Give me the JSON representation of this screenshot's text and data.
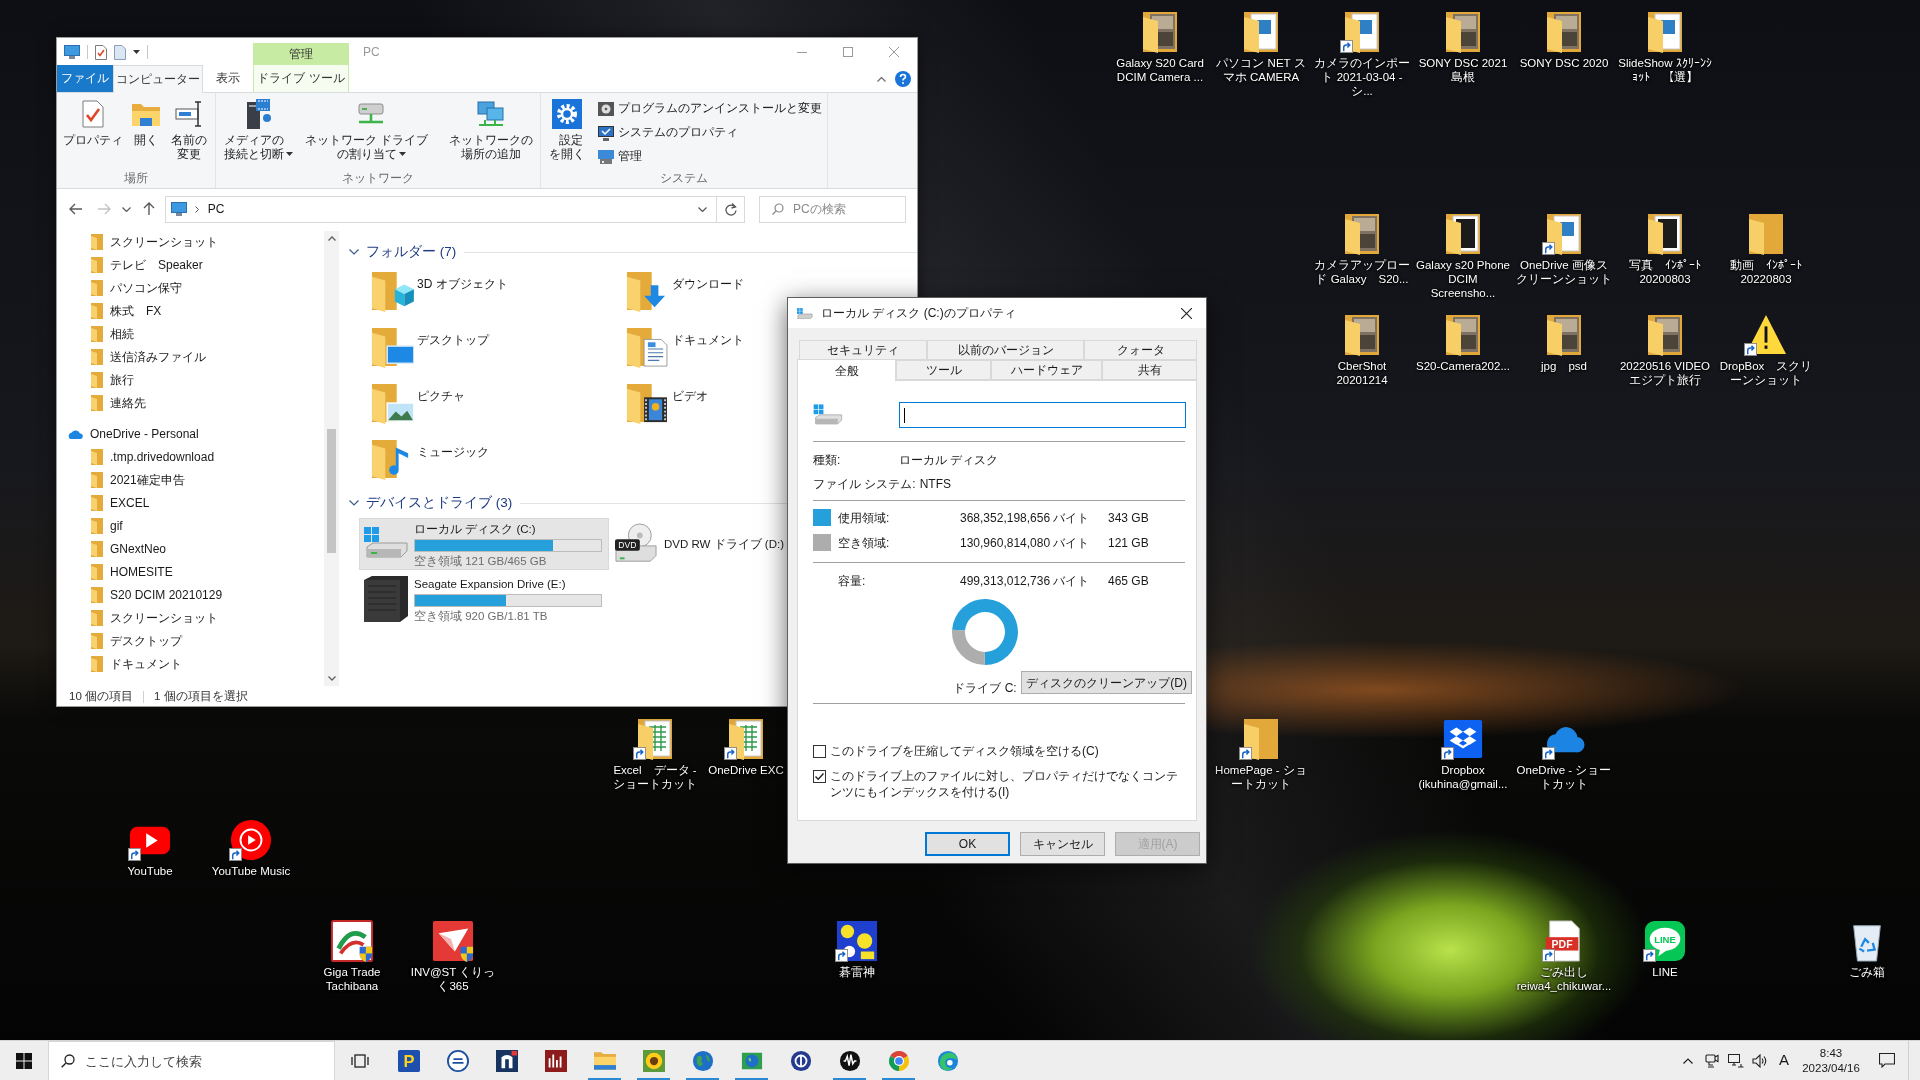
{
  "desktop_icons": [
    {
      "label": "Galaxy S20 Card DCIM Camera ...",
      "kind": "folder-photo",
      "shortcut": false
    },
    {
      "label": "パソコン NET スマホ CAMERA",
      "kind": "folder-doc",
      "shortcut": false
    },
    {
      "label": "カメラのインポート 2021-03-04 - シ...",
      "kind": "folder-doc",
      "shortcut": true
    },
    {
      "label": "SONY DSC 2021 島根",
      "kind": "folder-photo",
      "shortcut": false
    },
    {
      "label": "SONY DSC 2020",
      "kind": "folder-photo",
      "shortcut": false
    },
    {
      "label": "SlideShow ｽｸﾘｰﾝｼｮｯﾄ　【選】",
      "kind": "folder-doc",
      "shortcut": false
    },
    {
      "label": "カメラアップロード Galaxy　S20...",
      "kind": "folder-photo",
      "shortcut": false
    },
    {
      "label": "Galaxy s20 Phone DCIM Screensho...",
      "kind": "folder-dark",
      "shortcut": false
    },
    {
      "label": "OneDrive 画像スクリーンショット",
      "kind": "folder-doc",
      "shortcut": true
    },
    {
      "label": "写真　ｲﾝﾎﾟｰﾄ 20200803",
      "kind": "folder-dark",
      "shortcut": false
    },
    {
      "label": "動画　ｲﾝﾎﾟｰﾄ 20220803",
      "kind": "folder",
      "shortcut": false
    },
    {
      "label": "CberShot 20201214",
      "kind": "folder-photo",
      "shortcut": false
    },
    {
      "label": "S20-Camera202...",
      "kind": "folder-photo",
      "shortcut": false
    },
    {
      "label": "jpg　psd",
      "kind": "folder-photo",
      "shortcut": false
    },
    {
      "label": "20220516 VIDEO エジプト旅行",
      "kind": "folder-photo",
      "shortcut": false
    },
    {
      "label": "DropBox　スクリーンショット",
      "kind": "warning",
      "shortcut": true
    },
    {
      "label": "Excel　データ - ショートカット",
      "kind": "folder-sheet",
      "shortcut": true
    },
    {
      "label": "OneDrive EXC",
      "kind": "folder-sheet",
      "shortcut": true
    },
    {
      "label": "HomePage - ショートカット",
      "kind": "folder",
      "shortcut": true
    },
    {
      "label": "Dropbox (ikuhina@gmail...",
      "kind": "dropbox",
      "shortcut": true
    },
    {
      "label": "OneDrive - ショートカット",
      "kind": "cloud",
      "shortcut": true
    },
    {
      "label": "YouTube",
      "kind": "youtube",
      "shortcut": true
    },
    {
      "label": "YouTube Music",
      "kind": "youtube-music",
      "shortcut": true
    },
    {
      "label": "Giga Trade Tachibana",
      "kind": "giga",
      "shortcut": false
    },
    {
      "label": "INV@ST くりっく365",
      "kind": "invest",
      "shortcut": false
    },
    {
      "label": "碁雷神",
      "kind": "go-game",
      "shortcut": true
    },
    {
      "label": "ごみ出し reiwa4_chikuwar...",
      "kind": "pdf",
      "shortcut": true,
      "icon_text": "PDF"
    },
    {
      "label": "LINE",
      "kind": "line",
      "shortcut": true,
      "icon_text": "LINE"
    },
    {
      "label": "ごみ箱",
      "kind": "recycle-bin",
      "shortcut": false
    }
  ],
  "explorer": {
    "title": "PC",
    "context_header": "管理",
    "tabs": [
      {
        "label": "ファイル",
        "kind": "file",
        "selected": false
      },
      {
        "label": "コンピューター",
        "kind": "tab",
        "selected": true
      },
      {
        "label": "表示",
        "kind": "tab",
        "selected": false
      },
      {
        "label": "ドライブ ツール",
        "kind": "context",
        "selected": false
      }
    ],
    "ribbon_groups": [
      {
        "label": "場所",
        "buttons": [
          {
            "kind": "properties",
            "label": "プロパティ",
            "menu": false
          },
          {
            "kind": "open",
            "label": "開く",
            "menu": false
          },
          {
            "kind": "rename",
            "label": "名前の変更",
            "menu": false
          }
        ]
      },
      {
        "label": "ネットワーク",
        "buttons": [
          {
            "kind": "media",
            "label": "メディアの接続と切断",
            "menu": true
          },
          {
            "kind": "map-drive",
            "label": "ネットワーク ドライブの割り当て",
            "menu": true
          },
          {
            "kind": "add-location",
            "label": "ネットワークの場所の追加",
            "menu": false
          }
        ]
      },
      {
        "label": "システム",
        "buttons": [
          {
            "kind": "settings",
            "label": "設定を開く",
            "menu": false
          }
        ],
        "small_buttons": [
          {
            "kind": "uninstall",
            "label": "プログラムのアンインストールと変更"
          },
          {
            "kind": "system-properties",
            "label": "システムのプロパティ"
          },
          {
            "kind": "manage",
            "label": "管理"
          }
        ]
      }
    ],
    "nav_buttons": [
      {
        "kind": "back",
        "disabled": false
      },
      {
        "kind": "forward",
        "disabled": true
      },
      {
        "kind": "recent",
        "disabled": false
      },
      {
        "kind": "up",
        "disabled": false
      }
    ],
    "address": "PC",
    "search_placeholder": "PCの検索",
    "nav_tree": [
      {
        "kind": "scrolled-parent",
        "children": [
          {
            "kind": "folder",
            "label": "スクリーンショット"
          },
          {
            "kind": "folder",
            "label": "テレビ　Speaker"
          },
          {
            "kind": "folder",
            "label": "パソコン保守"
          },
          {
            "kind": "folder",
            "label": "株式　FX"
          },
          {
            "kind": "folder",
            "label": "相続"
          },
          {
            "kind": "folder",
            "label": "送信済みファイル"
          },
          {
            "kind": "folder",
            "label": "旅行"
          },
          {
            "kind": "folder",
            "label": "連絡先"
          }
        ]
      },
      {
        "kind": "onedrive",
        "label": "OneDrive - Personal",
        "children": [
          {
            "kind": "folder",
            "label": ".tmp.drivedownload"
          },
          {
            "kind": "folder",
            "label": "2021確定申告"
          },
          {
            "kind": "folder",
            "label": "EXCEL"
          },
          {
            "kind": "folder",
            "label": "gif"
          },
          {
            "kind": "folder",
            "label": "GNextNeo"
          },
          {
            "kind": "folder",
            "label": "HOMESITE"
          },
          {
            "kind": "folder",
            "label": "S20 DCIM 20210129"
          },
          {
            "kind": "folder",
            "label": "スクリーンショット"
          },
          {
            "kind": "folder",
            "label": "デスクトップ"
          },
          {
            "kind": "folder",
            "label": "ドキュメント"
          }
        ]
      }
    ],
    "sections": [
      {
        "kind": "folders",
        "title": "フォルダー (7)",
        "expanded": true,
        "items": [
          {
            "kind": "objects",
            "label": "3D オブジェクト"
          },
          {
            "kind": "download",
            "label": "ダウンロード"
          },
          {
            "kind": "desktop",
            "label": "デスクトップ"
          },
          {
            "kind": "documents",
            "label": "ドキュメント"
          },
          {
            "kind": "pictures",
            "label": "ピクチャ"
          },
          {
            "kind": "video",
            "label": "ビデオ"
          },
          {
            "kind": "music",
            "label": "ミュージック"
          }
        ]
      },
      {
        "kind": "drives",
        "title": "デバイスとドライブ (3)",
        "expanded": true,
        "items": [
          {
            "kind": "system-disk",
            "name": "ローカル ディスク (C:)",
            "selected": true,
            "level": 0.74,
            "free": "空き領域 121 GB/465 GB"
          },
          {
            "kind": "dvd",
            "name": "DVD RW ドライブ (D:)",
            "selected": false,
            "icon_text": "DVD"
          },
          {
            "kind": "external",
            "name": "Seagate Expansion Drive (E:)",
            "selected": false,
            "level": 0.49,
            "free": "空き領域 920 GB/1.81 TB"
          }
        ]
      }
    ],
    "status": [
      "10 個の項目",
      "1 個の項目を選択"
    ]
  },
  "properties_dialog": {
    "title": "ローカル ディスク (C:)のプロパティ",
    "tabs_back": [
      {
        "label": "セキュリティ",
        "selected": false
      },
      {
        "label": "以前のバージョン",
        "selected": false
      },
      {
        "label": "クォータ",
        "selected": false
      }
    ],
    "tabs_front": [
      {
        "label": "全般",
        "selected": true
      },
      {
        "label": "ツール",
        "selected": false
      },
      {
        "label": "ハードウェア",
        "selected": false
      },
      {
        "label": "共有",
        "selected": false
      }
    ],
    "name_field": {
      "focused": true
    },
    "info": [
      {
        "label": "種類:",
        "value": "ローカル ディスク"
      },
      {
        "label": "ファイル システム:",
        "value": "NTFS"
      }
    ],
    "usage": [
      {
        "label": "使用領域:",
        "bytes": "368,352,198,656 バイト",
        "size": "343 GB",
        "color": "#26a0da"
      },
      {
        "label": "空き領域:",
        "bytes": "130,960,814,080 バイト",
        "size": "121 GB",
        "color": "#adadad"
      }
    ],
    "capacity": {
      "label": "容量:",
      "bytes": "499,313,012,736 バイト",
      "size": "465 GB"
    },
    "chart_data": {
      "type": "donut",
      "title": "ドライブ C:",
      "values": [
        74,
        26
      ]
    },
    "cleanup_button": "ディスクのクリーンアップ(D)",
    "options": [
      {
        "label": "このドライブを圧縮してディスク領域を空ける(C)",
        "checked": false
      },
      {
        "label": "このドライブ上のファイルに対し、プロパティだけでなくコンテンツにもインデックスを付ける(I)",
        "checked": true
      }
    ],
    "buttons": [
      {
        "label": "OK",
        "kind": "default",
        "disabled": false
      },
      {
        "label": "キャンセル",
        "kind": "normal",
        "disabled": false
      },
      {
        "label": "適用(A)",
        "kind": "normal",
        "disabled": true
      }
    ]
  },
  "taskbar": {
    "search_placeholder": "ここに入力して検索",
    "apps": [
      {
        "kind": "p-logo",
        "running": false,
        "icon_text": "P"
      },
      {
        "kind": "round-blue",
        "running": false
      },
      {
        "kind": "n-tile",
        "running": false
      },
      {
        "kind": "chart-tile",
        "running": false
      },
      {
        "kind": "folder",
        "running": true
      },
      {
        "kind": "sunflower",
        "running": true
      },
      {
        "kind": "globe",
        "running": true
      },
      {
        "kind": "globe-window",
        "running": true
      },
      {
        "kind": "round-navy",
        "running": false
      },
      {
        "kind": "wave-circle",
        "running": true
      },
      {
        "kind": "chrome",
        "running": true
      },
      {
        "kind": "edge",
        "running": false
      }
    ],
    "ime": "A",
    "time": "8:43",
    "date": "2023/04/16"
  }
}
